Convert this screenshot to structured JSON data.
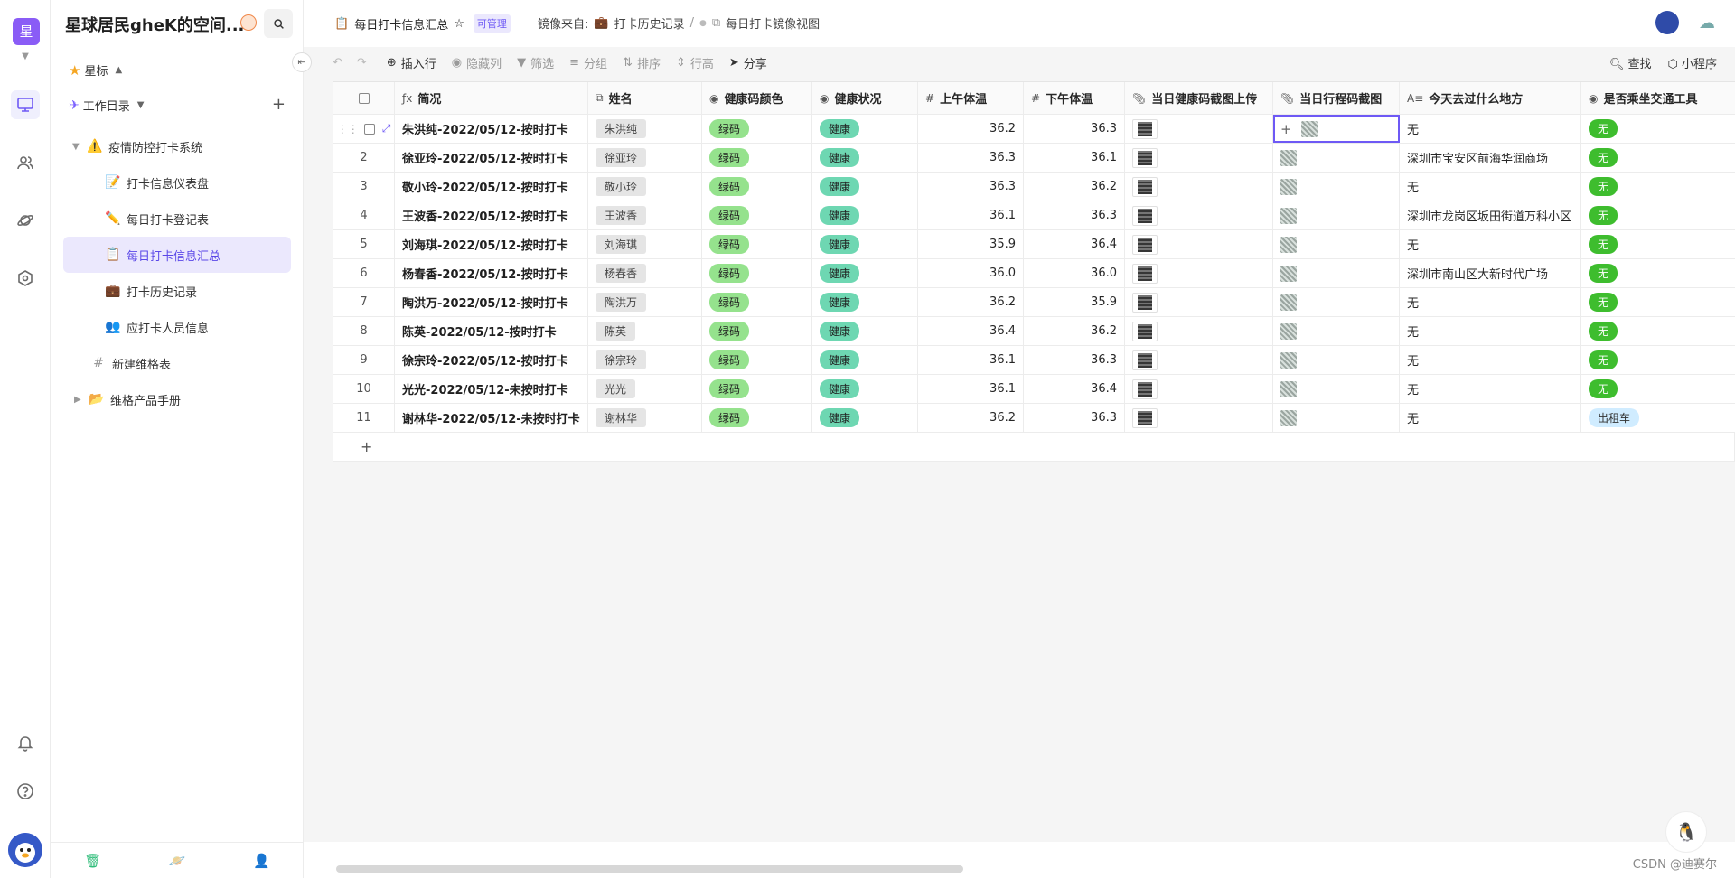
{
  "workspace": {
    "initial": "星",
    "name": "星球居民gheK的空间..."
  },
  "sidebar": {
    "star_label": "星标",
    "catalog_label": "工作目录",
    "items": [
      {
        "label": "疫情防控打卡系统",
        "icon": "warning-icon"
      },
      {
        "label": "打卡信息仪表盘",
        "icon": "memo-icon"
      },
      {
        "label": "每日打卡登记表",
        "icon": "pencil-icon"
      },
      {
        "label": "每日打卡信息汇总",
        "icon": "clipboard-icon"
      },
      {
        "label": "打卡历史记录",
        "icon": "briefcase-icon"
      },
      {
        "label": "应打卡人员信息",
        "icon": "people-icon"
      },
      {
        "label": "新建维格表",
        "icon": "grid-hash-icon"
      },
      {
        "label": "维格产品手册",
        "icon": "folder-icon"
      }
    ]
  },
  "header": {
    "title": "每日打卡信息汇总",
    "badge": "可管理",
    "mirror_from": "镜像来自:",
    "source": "打卡历史记录",
    "separator": "/",
    "view": "每日打卡镜像视图"
  },
  "toolbar": {
    "insert_row": "插入行",
    "hide_cols": "隐藏列",
    "filter": "筛选",
    "group": "分组",
    "sort": "排序",
    "row_height": "行高",
    "share": "分享",
    "find": "查找",
    "mini_program": "小程序"
  },
  "columns": {
    "brief": "简况",
    "name": "姓名",
    "color": "健康码颜色",
    "status": "健康状况",
    "am": "上午体温",
    "pm": "下午体温",
    "hc": "当日健康码截图上传",
    "tc": "当日行程码截图",
    "where": "今天去过什么地方",
    "trans": "是否乘坐交通工具"
  },
  "rows": [
    {
      "idx": "1",
      "brief": "朱洪纯-2022/05/12-按时打卡",
      "name": "朱洪纯",
      "color": "绿码",
      "status": "健康",
      "am": "36.2",
      "pm": "36.3",
      "where": "无",
      "trans": "无"
    },
    {
      "idx": "2",
      "brief": "徐亚玲-2022/05/12-按时打卡",
      "name": "徐亚玲",
      "color": "绿码",
      "status": "健康",
      "am": "36.3",
      "pm": "36.1",
      "where": "深圳市宝安区前海华润商场",
      "trans": "无"
    },
    {
      "idx": "3",
      "brief": "敬小玲-2022/05/12-按时打卡",
      "name": "敬小玲",
      "color": "绿码",
      "status": "健康",
      "am": "36.3",
      "pm": "36.2",
      "where": "无",
      "trans": "无"
    },
    {
      "idx": "4",
      "brief": "王波香-2022/05/12-按时打卡",
      "name": "王波香",
      "color": "绿码",
      "status": "健康",
      "am": "36.1",
      "pm": "36.3",
      "where": "深圳市龙岗区坂田街道万科小区",
      "trans": "无"
    },
    {
      "idx": "5",
      "brief": "刘海琪-2022/05/12-按时打卡",
      "name": "刘海琪",
      "color": "绿码",
      "status": "健康",
      "am": "35.9",
      "pm": "36.4",
      "where": "无",
      "trans": "无"
    },
    {
      "idx": "6",
      "brief": "杨春香-2022/05/12-按时打卡",
      "name": "杨春香",
      "color": "绿码",
      "status": "健康",
      "am": "36.0",
      "pm": "36.0",
      "where": "深圳市南山区大新时代广场",
      "trans": "无"
    },
    {
      "idx": "7",
      "brief": "陶洪万-2022/05/12-按时打卡",
      "name": "陶洪万",
      "color": "绿码",
      "status": "健康",
      "am": "36.2",
      "pm": "35.9",
      "where": "无",
      "trans": "无"
    },
    {
      "idx": "8",
      "brief": "陈英-2022/05/12-按时打卡",
      "name": "陈英",
      "color": "绿码",
      "status": "健康",
      "am": "36.4",
      "pm": "36.2",
      "where": "无",
      "trans": "无"
    },
    {
      "idx": "9",
      "brief": "徐宗玲-2022/05/12-按时打卡",
      "name": "徐宗玲",
      "color": "绿码",
      "status": "健康",
      "am": "36.1",
      "pm": "36.3",
      "where": "无",
      "trans": "无"
    },
    {
      "idx": "10",
      "brief": "光光-2022/05/12-未按时打卡",
      "name": "光光",
      "color": "绿码",
      "status": "健康",
      "am": "36.1",
      "pm": "36.4",
      "where": "无",
      "trans": "无"
    },
    {
      "idx": "11",
      "brief": "谢林华-2022/05/12-未按时打卡",
      "name": "谢林华",
      "color": "绿码",
      "status": "健康",
      "am": "36.2",
      "pm": "36.3",
      "where": "无",
      "trans": "出租车"
    }
  ],
  "add_row_symbol": "+",
  "watermark": "CSDN @迪赛尔",
  "colors": {
    "accent": "#6e59f5",
    "green_code": "#95e28d",
    "healthy": "#6ed7b2",
    "no_transport": "#3ebd2e",
    "taxi": "#d0ecff"
  }
}
